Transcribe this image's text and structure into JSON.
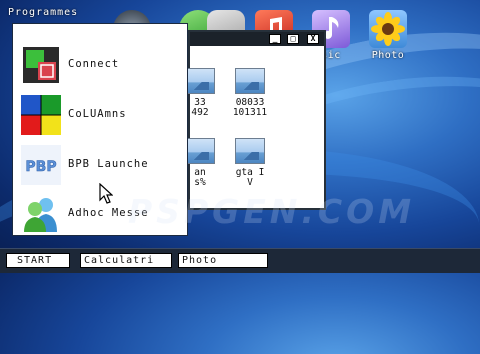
{
  "programmes_header": "Programmes",
  "desktop_icons": [
    {
      "label": ""
    },
    {
      "label": "sic"
    },
    {
      "label": "Photo"
    }
  ],
  "window": {
    "buttons": {
      "minimize": "_",
      "maximize": "□",
      "close": "X"
    },
    "files": [
      {
        "name_line1": "33",
        "name_line2": "492"
      },
      {
        "name_line1": "08033",
        "name_line2": "101311"
      },
      {
        "name_line1": "an",
        "name_line2": "s%"
      },
      {
        "name_line1": "gta I",
        "name_line2": "V"
      }
    ]
  },
  "menu": {
    "items": [
      {
        "label": "Connect",
        "icon": "connect-icon"
      },
      {
        "label": "CoLUAmns",
        "icon": "columns-game-icon"
      },
      {
        "label": "BPB Launche",
        "icon": "pbp-launcher-icon"
      },
      {
        "label": "Adhoc Messe",
        "icon": "messenger-icon"
      }
    ]
  },
  "taskbar": {
    "start_label": "START",
    "tasks": [
      "Calculatri",
      "Photo"
    ]
  },
  "watermark": "PSPGEN.COM",
  "colors": {
    "taskbar": "#1d2838",
    "desktop_accent": "#2f6fc4",
    "window_title": "#1b222a"
  }
}
